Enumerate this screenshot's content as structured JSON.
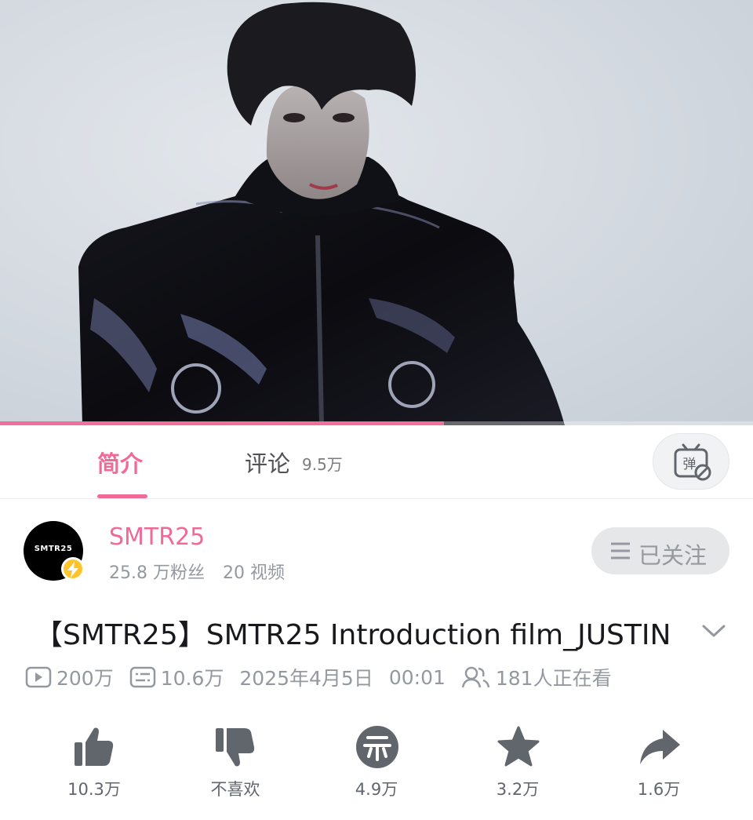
{
  "video": {
    "progress_fraction": 0.59
  },
  "tabs": {
    "intro_label": "简介",
    "comments_label": "评论",
    "comments_count": "9.5万",
    "danmaku_icon": "danmaku-off-icon"
  },
  "uploader": {
    "avatar_text": "SMTR25",
    "name": "SMTR25",
    "followers": "25.8 万粉丝",
    "videos": "20 视频",
    "follow_label": "已关注",
    "accent_color": "#f06a97"
  },
  "video_info": {
    "title": "【SMTR25】SMTR25 Introduction film_JUSTIN",
    "views": "200万",
    "danmaku_count": "10.6万",
    "date": "2025年4月5日",
    "time": "00:01",
    "watching": "181人正在看"
  },
  "actions": {
    "like_count": "10.3万",
    "dislike_label": "不喜欢",
    "coin_count": "4.9万",
    "favorite_count": "3.2万",
    "share_count": "1.6万"
  }
}
